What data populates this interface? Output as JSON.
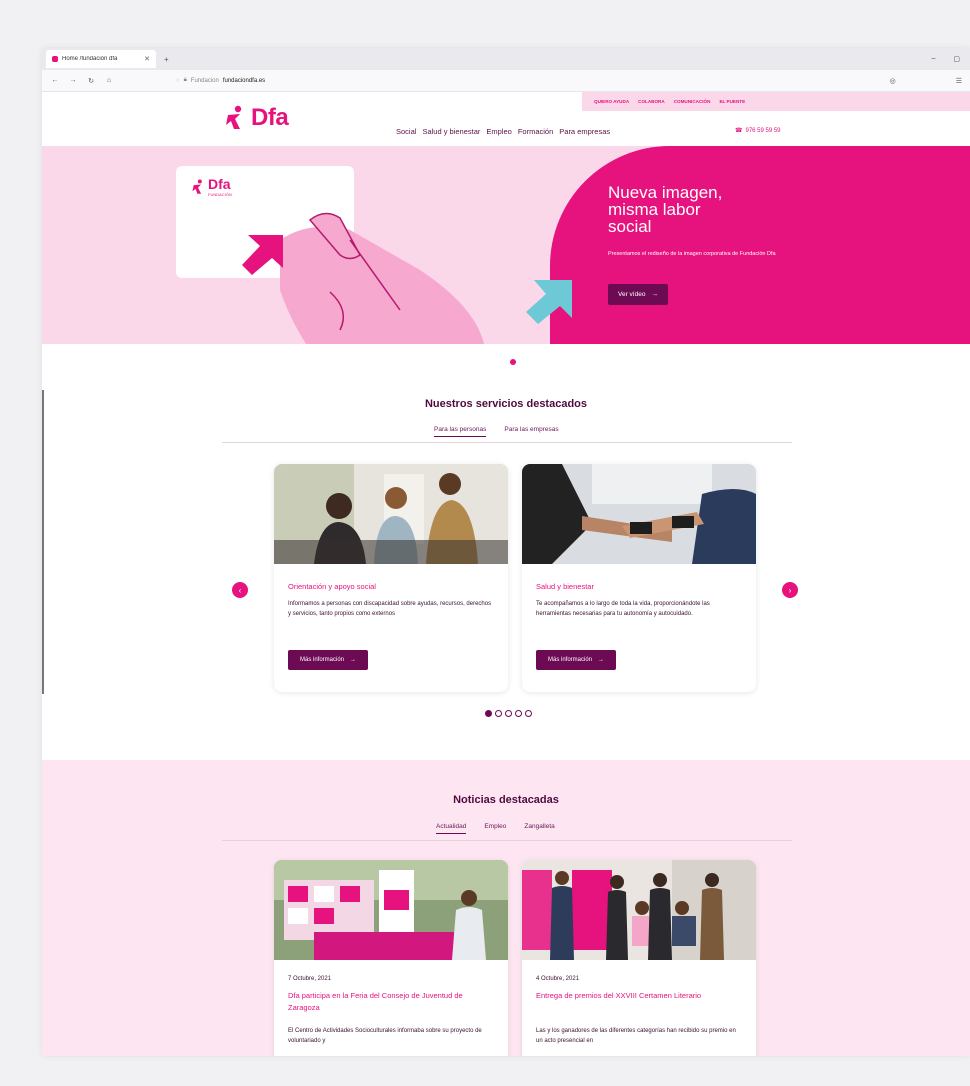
{
  "browser": {
    "tab_title": "Home /fundación dfa",
    "url_prefix": "Fundacion",
    "url_host": "fundaciondfa.es"
  },
  "topbar": [
    "QUIERO AYUDA",
    "COLABORA",
    "COMUNICACIÓN",
    "EL PUENTE"
  ],
  "logo": {
    "mark": "ẛ",
    "text": "Dfa"
  },
  "nav": [
    "Social",
    "Salud y bienestar",
    "Empleo",
    "Formación",
    "Para empresas"
  ],
  "phone": "976 59 59 59",
  "hero": {
    "title_lines": [
      "Nueva imagen,",
      "misma labor",
      "social"
    ],
    "subtitle": "Presentamos el rediseño de la imagen corporativa de Fundación Dfa",
    "button": "Ver vídeo",
    "card_brand": "Dfa",
    "card_sub": "FUNDACIÓN"
  },
  "services": {
    "title": "Nuestros servicios destacados",
    "tabs": [
      "Para las personas",
      "Para las empresas"
    ],
    "cards": [
      {
        "title": "Orientación y apoyo social",
        "text": "Informamos a personas con discapacidad sobre ayudas, recursos, derechos y servicios, tanto propios como externos",
        "button": "Más información"
      },
      {
        "title": "Salud y bienestar",
        "text": "Te acompañamos a lo largo de toda la vida, proporcionándote las herramientas necesarias para tu autonomía y autocuidado.",
        "button": "Más información"
      }
    ],
    "dots_total": 5,
    "dots_active": 1
  },
  "news": {
    "title": "Noticias destacadas",
    "tabs": [
      "Actualidad",
      "Empleo",
      "Zangalleta"
    ],
    "cards": [
      {
        "date": "7 Octubre, 2021",
        "title": "Dfa participa en la Feria del Consejo de Juventud de Zaragoza",
        "text": "El Centro de Actividades Socioculturales informaba sobre su proyecto de voluntariado y"
      },
      {
        "date": "4 Octubre, 2021",
        "title": "Entrega de premios del XXVIII Certamen Literario",
        "text": "Las y los ganadores de las diferentes categorías han recibido su premio en un acto presencial en"
      }
    ]
  },
  "colors": {
    "brand_pink": "#e6127d",
    "brand_purple": "#6c0b54",
    "light_pink": "#fbd7ea"
  },
  "icons": {
    "arrow_right": "→",
    "prev": "‹",
    "next": "›",
    "phone": "☎"
  }
}
